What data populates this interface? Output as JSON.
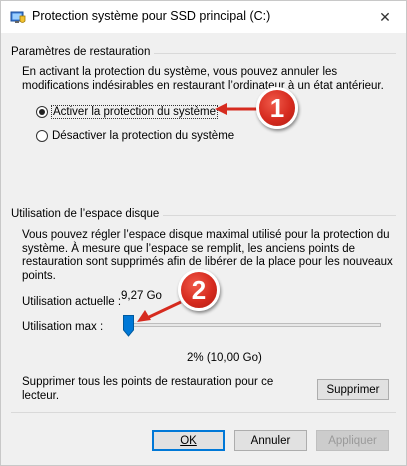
{
  "window": {
    "title": "Protection système pour SSD principal (C:)",
    "close_icon": "close-icon"
  },
  "restore_settings": {
    "group_title": "Paramètres de restauration",
    "description_lines": [
      "En activant la protection du système, vous pouvez annuler les",
      "modifications indésirables en restaurant l’ordinateur à un état antérieur."
    ],
    "options": [
      {
        "label": "Activer la protection du système",
        "selected": true
      },
      {
        "label": "Désactiver la protection du système",
        "selected": false
      }
    ]
  },
  "disk_usage": {
    "group_title": "Utilisation de l’espace disque",
    "description_lines": [
      "Vous pouvez régler l’espace disque maximal utilisé pour la protection du",
      "système. À mesure que l’espace se remplit, les anciens points de",
      "restauration sont supprimés afin de libérer de la place pour les nouveaux",
      "points."
    ],
    "current_label": "Utilisation actuelle :",
    "current_value": "9,27 Go",
    "max_label": "Utilisation max :",
    "max_percent_label": "2% (10,00 Go)",
    "slider_fraction": 0.0
  },
  "delete_points": {
    "text_lines": [
      "Supprimer tous les points de restauration pour ce",
      "lecteur."
    ],
    "button_label": "Supprimer"
  },
  "footer": {
    "ok_label": "OK",
    "cancel_label": "Annuler",
    "apply_label": "Appliquer"
  },
  "annotations": {
    "badge1": "1",
    "badge2": "2",
    "color": "#d62b1f"
  },
  "colors": {
    "accent": "#0078d7",
    "slider_thumb": "#0078d7"
  }
}
